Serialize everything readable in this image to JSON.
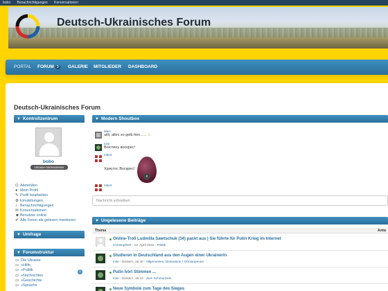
{
  "topbar": {
    "user": "bobo",
    "notifications": "Benachrichtigungen",
    "conversations": "Konversationen"
  },
  "banner": {
    "title": "Deutsch-Ukrainisches Forum"
  },
  "nav": {
    "portal": "PORTAL",
    "forum": "FORUM",
    "forum_count": "3",
    "galerie": "GALERIE",
    "mitglieder": "MITGLIEDER",
    "dashboard": "DASHBOARD"
  },
  "page_title": "Deutsch-Ukrainisches Forum",
  "sidebar": {
    "kontrollzentrum": "Kontrollzentrum",
    "username": "bobo",
    "user_title": "Ukraine-Interessierter",
    "menu": [
      {
        "label": "Abmelden",
        "icon": "logout-icon"
      },
      {
        "label": "Mein Profil",
        "icon": "user-icon"
      },
      {
        "label": "Profil bearbeiten",
        "icon": "edit-icon"
      },
      {
        "label": "Einstellungen",
        "icon": "settings-icon"
      },
      {
        "label": "Benachrichtigungen",
        "icon": "bell-icon"
      },
      {
        "label": "Konversationen",
        "icon": "chat-icon"
      },
      {
        "label": "Benutzer online",
        "icon": "users-icon"
      },
      {
        "label": "Alle Foren als gelesen markieren",
        "icon": "check-icon"
      }
    ],
    "umfrage": "Umfrage",
    "forumstruktur": "Forumstruktur",
    "forums": [
      {
        "label": "Die Ukraine"
      },
      {
        "label": "»Hilfe"
      },
      {
        "label": "»Politik"
      },
      {
        "label": "»Nachrichten"
      },
      {
        "label": "»Geschichte"
      },
      {
        "label": "»Sprache"
      }
    ],
    "forum_badge": "1"
  },
  "shoutbox": {
    "title": "Modern Shoutbox",
    "messages": [
      {
        "user": "Marc",
        "text": "uiiii, alles so gelb hier......"
      },
      {
        "user": "Icke",
        "text": "Воістину воскрес!"
      },
      {
        "user": "mbert",
        "text": "Христос Воскрес!"
      },
      {
        "user": "mbert",
        "text": ""
      }
    ],
    "input_placeholder": "Nachricht schreiben"
  },
  "unread": {
    "title": "Ungelesene Beiträge",
    "col_thema": "Thema",
    "col_antworten": "Antw",
    "threads": [
      {
        "title": "Online-Troll Ludmilla Sawtschuk (34) packt aus | Sie führte für Putin Krieg im Internet",
        "author": "ChristophHE",
        "date": "12. April 2015",
        "forum": "Politik",
        "extra": ""
      },
      {
        "title": "Studieren in Deutschland aus den Augen einer Ukrainerin",
        "author": "Icke",
        "date": "Gestern, 15:40",
        "forum": "Allgemeines, Diskussion / Обговорення",
        "extra": ""
      },
      {
        "title": "Putin hört Stimmen ...",
        "author": "Icke",
        "date": "Gestern, 15:13",
        "forum": "Zum Schmunzeln",
        "extra": ""
      },
      {
        "title": "Neue Symbole zum Tage des Sieges",
        "author": "",
        "date": "",
        "forum": "",
        "extra": ""
      }
    ]
  },
  "colors": {
    "accent": "#2a6f9c",
    "header": "#3f8fbf",
    "background": "#ffd400"
  }
}
